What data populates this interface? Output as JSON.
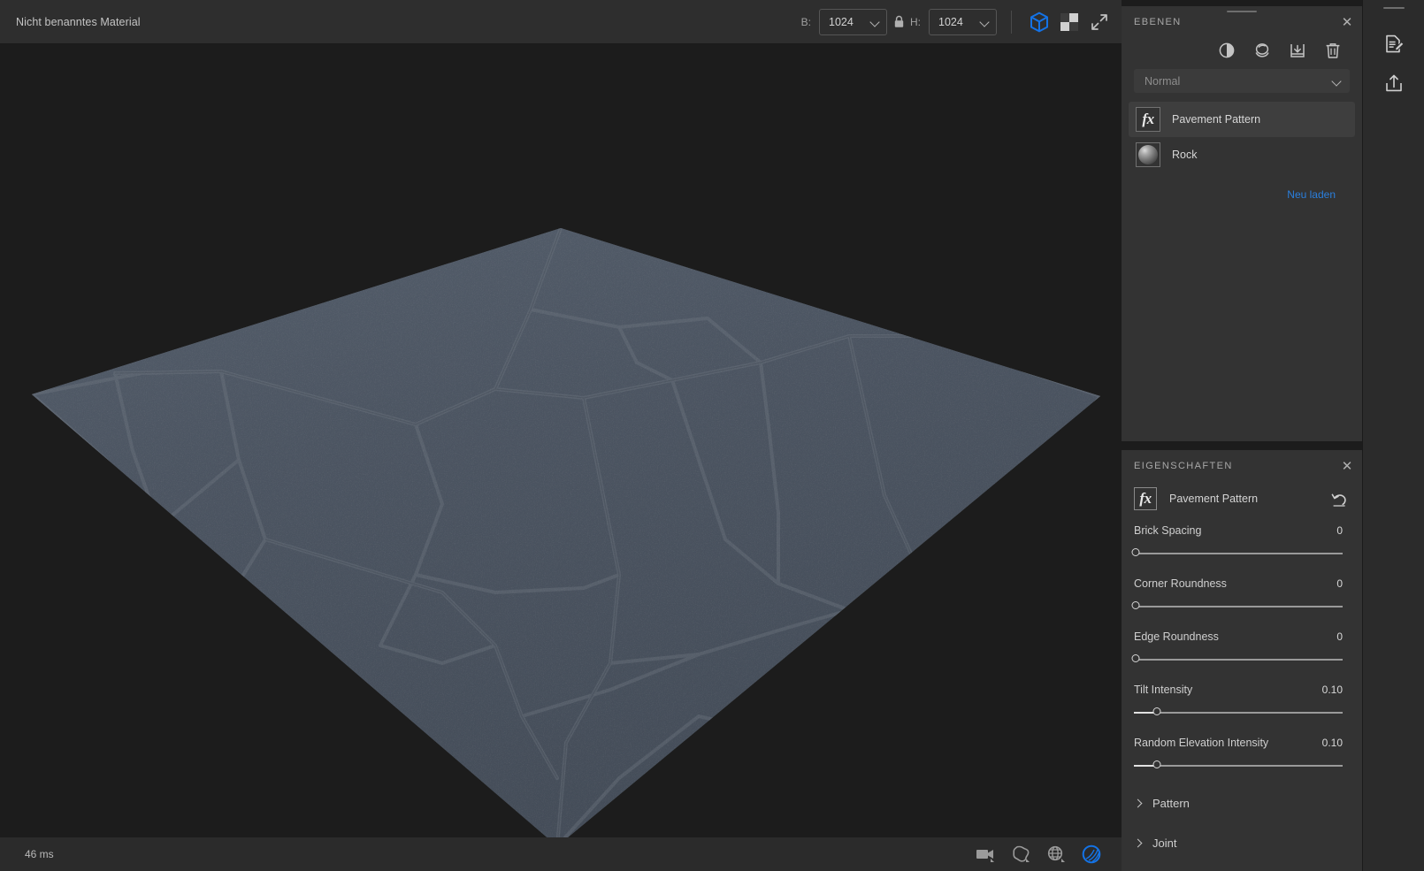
{
  "toolbar": {
    "material_title": "Nicht benanntes Material",
    "width_label": "B:",
    "width_value": "1024",
    "height_label": "H:",
    "height_value": "1024",
    "lock_icon": "lock-icon",
    "view_3d_icon": "cube-3d-icon",
    "view_2d_icon": "checkerboard-2d-icon",
    "fullscreen_icon": "expand-arrows-icon",
    "accent_color": "#1473e6"
  },
  "viewport": {
    "render_time": "46 ms",
    "icons": [
      {
        "name": "camera-icon"
      },
      {
        "name": "shape-blob-icon"
      },
      {
        "name": "environment-globe-icon"
      },
      {
        "name": "material-sphere-icon"
      }
    ]
  },
  "layers_panel": {
    "title": "EBENEN",
    "close_icon": "close-icon",
    "tools": [
      {
        "name": "adjustment-circle-icon"
      },
      {
        "name": "material-stack-icon"
      },
      {
        "name": "import-layer-icon"
      },
      {
        "name": "delete-layer-icon"
      }
    ],
    "blend_mode": "Normal",
    "layers": [
      {
        "name": "Pavement Pattern",
        "thumb": "fx-thumb",
        "selected": true
      },
      {
        "name": "Rock",
        "thumb": "sphere-thumb",
        "selected": false
      }
    ],
    "reload_label": "Neu laden",
    "link_color": "#2a7fdd"
  },
  "properties_panel": {
    "title": "EIGENSCHAFTEN",
    "close_icon": "close-icon",
    "effect_name": "Pavement Pattern",
    "effect_thumb": "fx-thumb",
    "reset_icon": "undo-reset-icon",
    "sliders": [
      {
        "label": "Brick Spacing",
        "value": "0",
        "pct": 0
      },
      {
        "label": "Corner Roundness",
        "value": "0",
        "pct": 0
      },
      {
        "label": "Edge Roundness",
        "value": "0",
        "pct": 0
      },
      {
        "label": "Tilt Intensity",
        "value": "0.10",
        "pct": 11
      },
      {
        "label": "Random Elevation Intensity",
        "value": "0.10",
        "pct": 11
      }
    ],
    "sections": [
      {
        "label": "Pattern",
        "expanded": false
      },
      {
        "label": "Joint",
        "expanded": false
      }
    ]
  },
  "rail": {
    "buttons": [
      {
        "name": "edit-document-icon"
      },
      {
        "name": "export-upload-icon"
      }
    ]
  }
}
